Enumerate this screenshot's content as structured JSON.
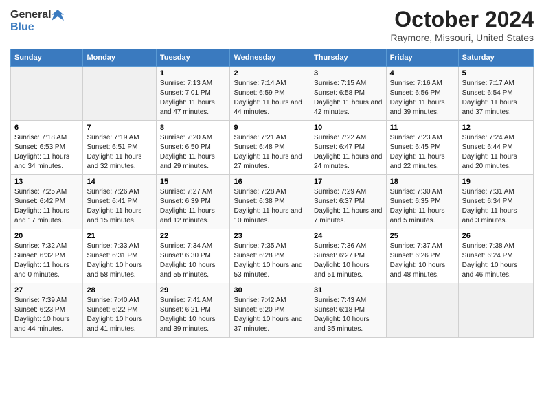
{
  "header": {
    "logo_general": "General",
    "logo_blue": "Blue",
    "title": "October 2024",
    "subtitle": "Raymore, Missouri, United States"
  },
  "days_of_week": [
    "Sunday",
    "Monday",
    "Tuesday",
    "Wednesday",
    "Thursday",
    "Friday",
    "Saturday"
  ],
  "weeks": [
    [
      {
        "day": null,
        "info": null
      },
      {
        "day": null,
        "info": null
      },
      {
        "day": "1",
        "sunrise": "7:13 AM",
        "sunset": "7:01 PM",
        "daylight": "11 hours and 47 minutes."
      },
      {
        "day": "2",
        "sunrise": "7:14 AM",
        "sunset": "6:59 PM",
        "daylight": "11 hours and 44 minutes."
      },
      {
        "day": "3",
        "sunrise": "7:15 AM",
        "sunset": "6:58 PM",
        "daylight": "11 hours and 42 minutes."
      },
      {
        "day": "4",
        "sunrise": "7:16 AM",
        "sunset": "6:56 PM",
        "daylight": "11 hours and 39 minutes."
      },
      {
        "day": "5",
        "sunrise": "7:17 AM",
        "sunset": "6:54 PM",
        "daylight": "11 hours and 37 minutes."
      }
    ],
    [
      {
        "day": "6",
        "sunrise": "7:18 AM",
        "sunset": "6:53 PM",
        "daylight": "11 hours and 34 minutes."
      },
      {
        "day": "7",
        "sunrise": "7:19 AM",
        "sunset": "6:51 PM",
        "daylight": "11 hours and 32 minutes."
      },
      {
        "day": "8",
        "sunrise": "7:20 AM",
        "sunset": "6:50 PM",
        "daylight": "11 hours and 29 minutes."
      },
      {
        "day": "9",
        "sunrise": "7:21 AM",
        "sunset": "6:48 PM",
        "daylight": "11 hours and 27 minutes."
      },
      {
        "day": "10",
        "sunrise": "7:22 AM",
        "sunset": "6:47 PM",
        "daylight": "11 hours and 24 minutes."
      },
      {
        "day": "11",
        "sunrise": "7:23 AM",
        "sunset": "6:45 PM",
        "daylight": "11 hours and 22 minutes."
      },
      {
        "day": "12",
        "sunrise": "7:24 AM",
        "sunset": "6:44 PM",
        "daylight": "11 hours and 20 minutes."
      }
    ],
    [
      {
        "day": "13",
        "sunrise": "7:25 AM",
        "sunset": "6:42 PM",
        "daylight": "11 hours and 17 minutes."
      },
      {
        "day": "14",
        "sunrise": "7:26 AM",
        "sunset": "6:41 PM",
        "daylight": "11 hours and 15 minutes."
      },
      {
        "day": "15",
        "sunrise": "7:27 AM",
        "sunset": "6:39 PM",
        "daylight": "11 hours and 12 minutes."
      },
      {
        "day": "16",
        "sunrise": "7:28 AM",
        "sunset": "6:38 PM",
        "daylight": "11 hours and 10 minutes."
      },
      {
        "day": "17",
        "sunrise": "7:29 AM",
        "sunset": "6:37 PM",
        "daylight": "11 hours and 7 minutes."
      },
      {
        "day": "18",
        "sunrise": "7:30 AM",
        "sunset": "6:35 PM",
        "daylight": "11 hours and 5 minutes."
      },
      {
        "day": "19",
        "sunrise": "7:31 AM",
        "sunset": "6:34 PM",
        "daylight": "11 hours and 3 minutes."
      }
    ],
    [
      {
        "day": "20",
        "sunrise": "7:32 AM",
        "sunset": "6:32 PM",
        "daylight": "11 hours and 0 minutes."
      },
      {
        "day": "21",
        "sunrise": "7:33 AM",
        "sunset": "6:31 PM",
        "daylight": "10 hours and 58 minutes."
      },
      {
        "day": "22",
        "sunrise": "7:34 AM",
        "sunset": "6:30 PM",
        "daylight": "10 hours and 55 minutes."
      },
      {
        "day": "23",
        "sunrise": "7:35 AM",
        "sunset": "6:28 PM",
        "daylight": "10 hours and 53 minutes."
      },
      {
        "day": "24",
        "sunrise": "7:36 AM",
        "sunset": "6:27 PM",
        "daylight": "10 hours and 51 minutes."
      },
      {
        "day": "25",
        "sunrise": "7:37 AM",
        "sunset": "6:26 PM",
        "daylight": "10 hours and 48 minutes."
      },
      {
        "day": "26",
        "sunrise": "7:38 AM",
        "sunset": "6:24 PM",
        "daylight": "10 hours and 46 minutes."
      }
    ],
    [
      {
        "day": "27",
        "sunrise": "7:39 AM",
        "sunset": "6:23 PM",
        "daylight": "10 hours and 44 minutes."
      },
      {
        "day": "28",
        "sunrise": "7:40 AM",
        "sunset": "6:22 PM",
        "daylight": "10 hours and 41 minutes."
      },
      {
        "day": "29",
        "sunrise": "7:41 AM",
        "sunset": "6:21 PM",
        "daylight": "10 hours and 39 minutes."
      },
      {
        "day": "30",
        "sunrise": "7:42 AM",
        "sunset": "6:20 PM",
        "daylight": "10 hours and 37 minutes."
      },
      {
        "day": "31",
        "sunrise": "7:43 AM",
        "sunset": "6:18 PM",
        "daylight": "10 hours and 35 minutes."
      },
      {
        "day": null,
        "info": null
      },
      {
        "day": null,
        "info": null
      }
    ]
  ]
}
